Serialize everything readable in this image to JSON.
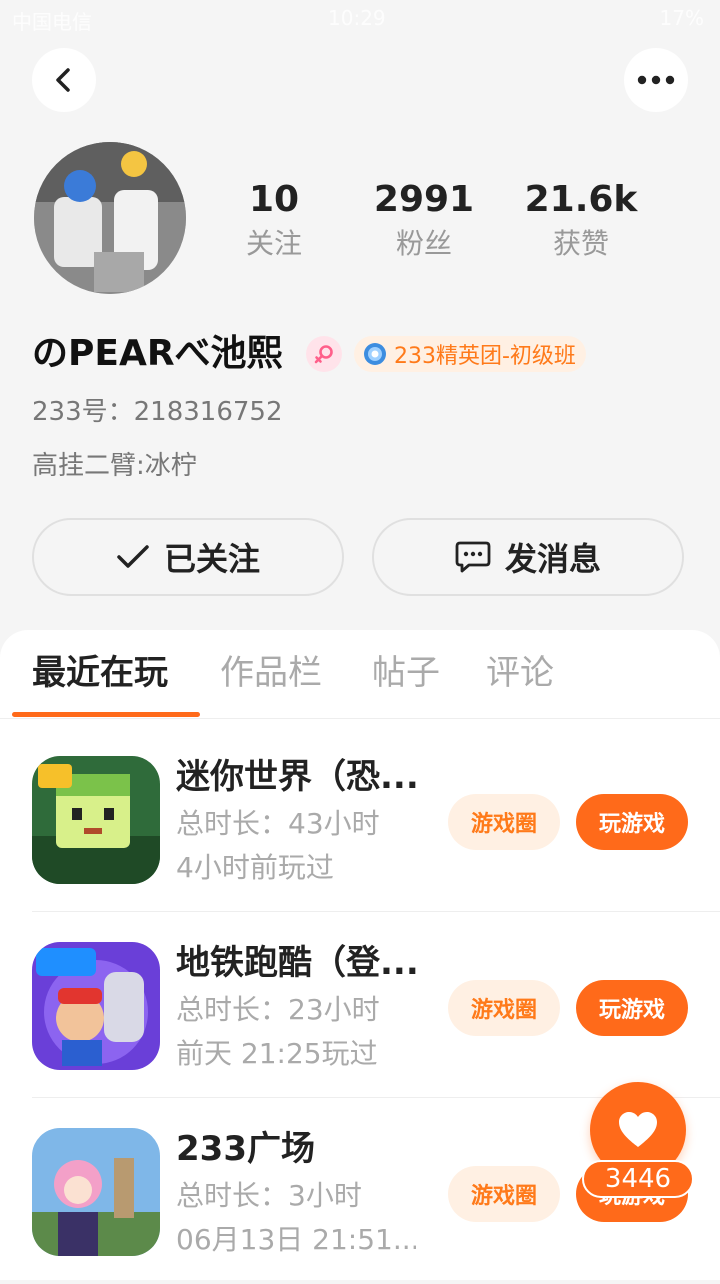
{
  "status_bar": {
    "carrier": "中国电信",
    "time": "10:29",
    "battery": "17%"
  },
  "colors": {
    "accent": "#ff6a1a",
    "chip_bg": "#fff0e3",
    "background": "#f5f5f5"
  },
  "profile": {
    "username": "のPEARべ池熙",
    "elite_badge": "233精英团-初级班",
    "id_line": "233号：218316752",
    "signature": "高挂二臂:冰柠",
    "stats": [
      {
        "value": "10",
        "label": "关注"
      },
      {
        "value": "2991",
        "label": "粉丝"
      },
      {
        "value": "21.6k",
        "label": "获赞"
      }
    ]
  },
  "actions": {
    "follow_label": "已关注",
    "message_label": "发消息"
  },
  "tabs": [
    {
      "label": "最近在玩",
      "active": true
    },
    {
      "label": "作品栏",
      "active": false
    },
    {
      "label": "帖子",
      "active": false
    },
    {
      "label": "评论",
      "active": false
    }
  ],
  "games": [
    {
      "title": "迷你世界（恐...",
      "duration": "总时长：43小时",
      "last_played": "4小时前玩过",
      "circle_label": "游戏圈",
      "play_label": "玩游戏"
    },
    {
      "title": "地铁跑酷（登...",
      "duration": "总时长：23小时",
      "last_played": "前天 21:25玩过",
      "circle_label": "游戏圈",
      "play_label": "玩游戏"
    },
    {
      "title": "233广场",
      "duration": "总时长：3小时",
      "last_played": "06月13日 21:51...",
      "circle_label": "游戏圈",
      "play_label": "玩游戏"
    }
  ],
  "like_fab": {
    "count": "3446",
    "icon": "heart-icon"
  },
  "icons": {
    "back": "back-arrow-icon",
    "more": "more-dots-icon",
    "gender": "female-icon",
    "elite": "elite-medal-icon",
    "follow": "checkmark-icon",
    "message": "chat-bubble-icon"
  }
}
